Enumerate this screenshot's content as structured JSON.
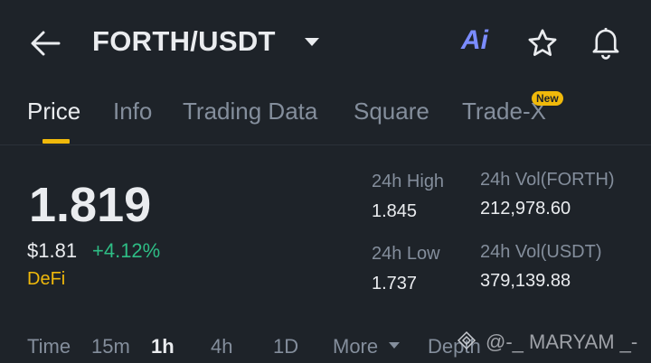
{
  "header": {
    "title": "FORTH/USDT",
    "ai_label": "Ai",
    "icons": [
      "back-arrow-icon",
      "dropdown-caret-icon",
      "star-icon",
      "bell-icon"
    ]
  },
  "tabs": [
    {
      "label": "Price",
      "active": true
    },
    {
      "label": "Info"
    },
    {
      "label": "Trading Data"
    },
    {
      "label": "Square"
    },
    {
      "label": "Trade-X",
      "badge": "New"
    }
  ],
  "price": {
    "last": "1.819",
    "usd": "$1.81",
    "change_pct": "+4.12%",
    "tag": "DeFi"
  },
  "stats": {
    "high_label": "24h High",
    "high_value": "1.845",
    "low_label": "24h Low",
    "low_value": "1.737",
    "vol_base_label": "24h Vol(FORTH)",
    "vol_base_value": "212,978.60",
    "vol_quote_label": "24h Vol(USDT)",
    "vol_quote_value": "379,139.88"
  },
  "timebar": {
    "time": "Time",
    "m15": "15m",
    "h1": "1h",
    "h4": "4h",
    "d1": "1D",
    "more": "More",
    "depth": "Depth"
  },
  "watermark": "@-_ MARYAM _-",
  "colors": {
    "background": "#1e2329",
    "accent": "#f0b90b",
    "positive": "#2ebd85",
    "muted": "#848e9c"
  }
}
